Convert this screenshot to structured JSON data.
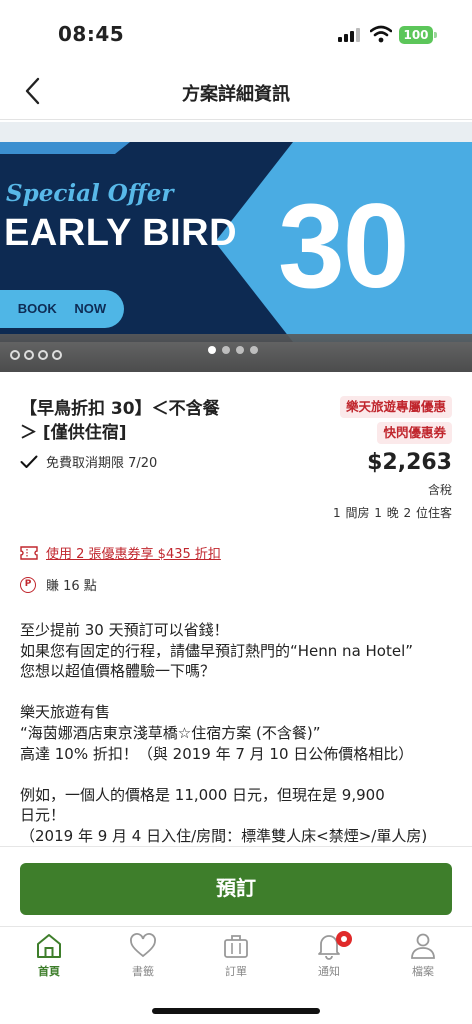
{
  "status_bar": {
    "time": "08:45",
    "battery": "100"
  },
  "header": {
    "title": "方案詳細資訊"
  },
  "banner": {
    "special": "Special Offer",
    "headline": "EARLY BIRD",
    "cta": "BOOK NOW",
    "number": "30",
    "slide_index": 1,
    "slide_count": 4
  },
  "plan": {
    "title_line1": "【早鳥折扣 30】＜不含餐",
    "title_line2": "＞ [僅供住宿]",
    "cancellation": "免費取消期限 7/20",
    "badge_exclusive": "樂天旅遊專屬優惠",
    "badge_flash": "快閃優惠券",
    "price": "$2,263",
    "tax_note": "含稅",
    "occupancy": "1 間房 1 晚 2 位住客",
    "coupon_text": "使用 2 張優惠券享 $435 折扣",
    "points_text": "賺 16 點"
  },
  "description": [
    "至少提前 30 天預訂可以省錢！",
    "如果您有固定的行程，請儘早預訂熱門的“Henn na Hotel”",
    "您想以超值價格體驗一下嗎？",
    "",
    "樂天旅遊有售",
    "“海茵娜酒店東京淺草橋☆住宿方案 (不含餐)”",
    "高達 10% 折扣！（與 2019 年 7 月 10 日公佈價格相比）",
    "",
    "例如，一個人的價格是 11,000 日元，但現在是 9,900",
    "日元！",
    "（2019 年 9 月 4 日入住/房間：標準雙人床<禁煙>/單人房)"
  ],
  "book_button": "預訂",
  "tabs": [
    {
      "label": "首頁",
      "icon": "home-icon",
      "active": true
    },
    {
      "label": "書籤",
      "icon": "heart-icon",
      "active": false
    },
    {
      "label": "訂單",
      "icon": "suitcase-icon",
      "active": false
    },
    {
      "label": "通知",
      "icon": "bell-icon",
      "active": false
    },
    {
      "label": "檔案",
      "icon": "profile-icon",
      "active": false
    }
  ],
  "colors": {
    "accent_green": "#3e7e2b",
    "promo_red": "#c0262d",
    "banner_navy": "#0d2a52",
    "banner_blue": "#4fb6e6"
  }
}
